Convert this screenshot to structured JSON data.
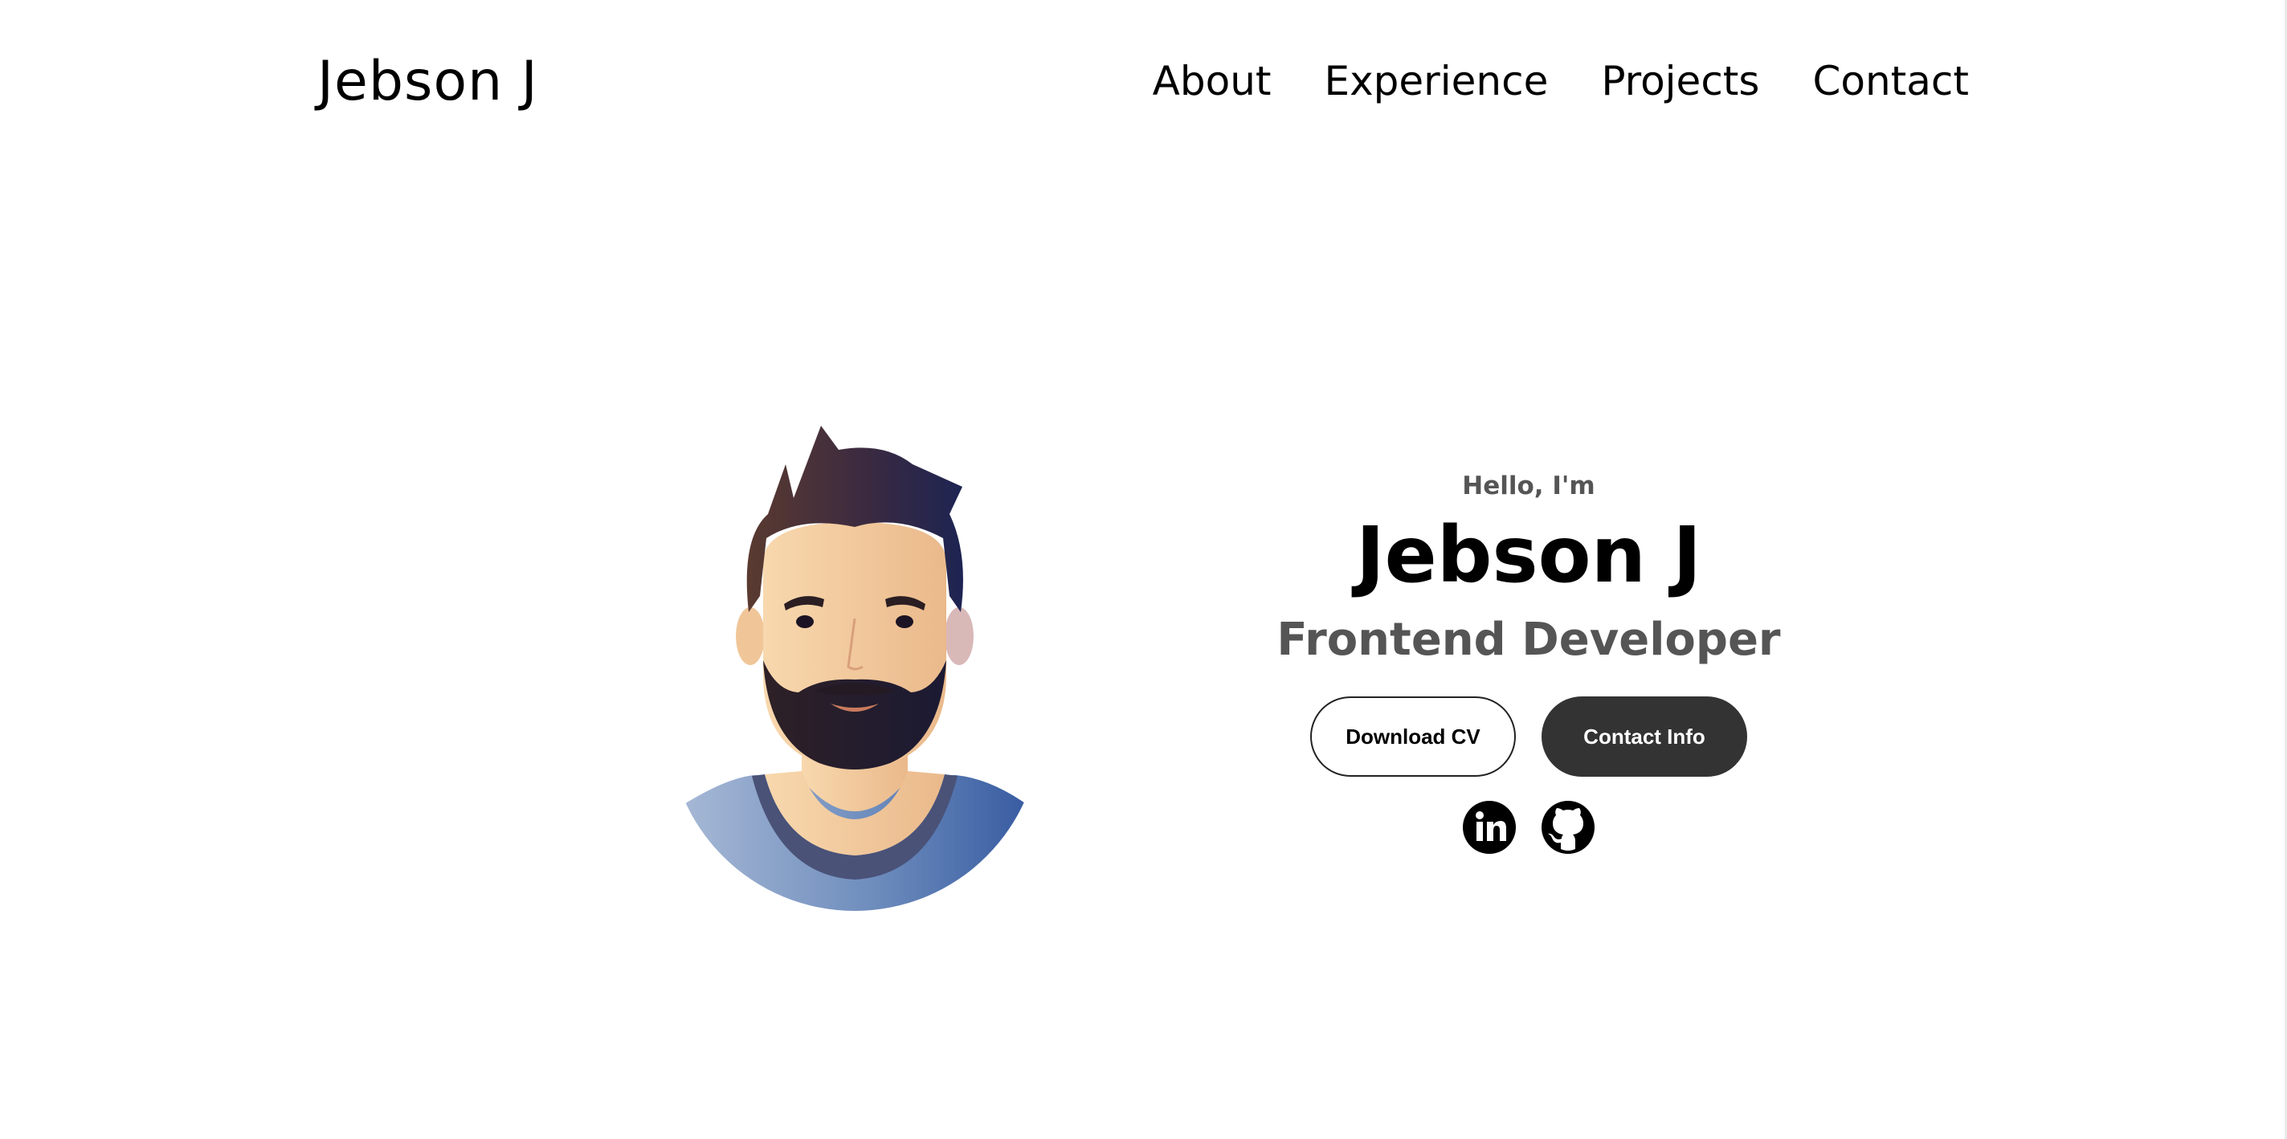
{
  "header": {
    "logo": "Jebson J",
    "nav": [
      "About",
      "Experience",
      "Projects",
      "Contact"
    ]
  },
  "hero": {
    "greeting": "Hello, I'm",
    "name": "Jebson J",
    "role": "Frontend Developer",
    "buttons": {
      "download_cv": "Download CV",
      "contact_info": "Contact Info"
    },
    "social_icons": [
      "linkedin-icon",
      "github-icon"
    ],
    "avatar": "bearded-man-avatar-illustration"
  },
  "colors": {
    "background": "#ffffff",
    "text": "#000000",
    "muted_text": "#555555",
    "button_dark": "#333333"
  }
}
